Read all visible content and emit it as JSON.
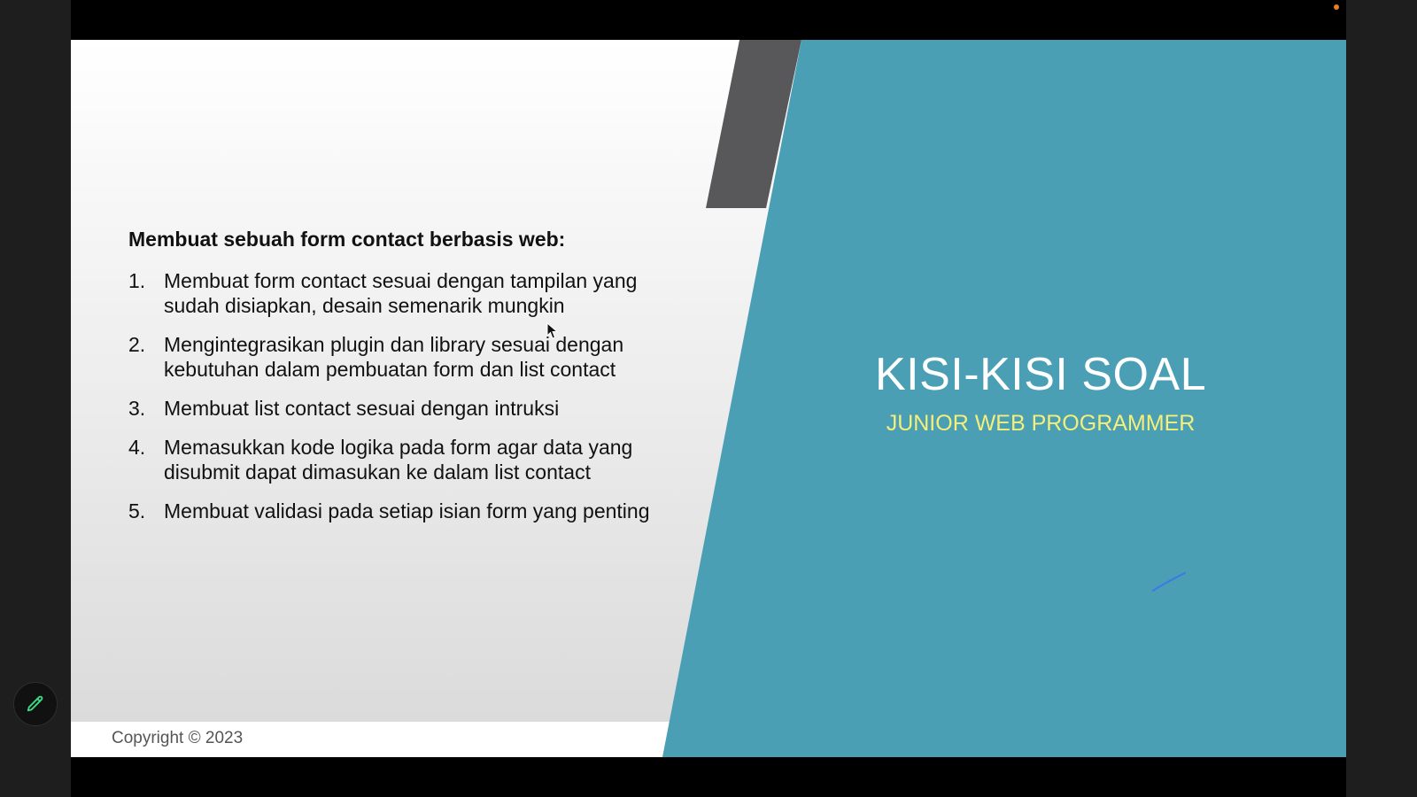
{
  "slide": {
    "heading": "Membuat sebuah form contact berbasis web:",
    "tasks": [
      {
        "num": "1.",
        "text": "Membuat form contact sesuai dengan tampilan yang sudah disiapkan, desain semenarik mungkin"
      },
      {
        "num": "2.",
        "text": "Mengintegrasikan plugin dan library sesuai dengan kebutuhan dalam pembuatan form dan list contact"
      },
      {
        "num": "3.",
        "text": "Membuat list contact sesuai dengan intruksi"
      },
      {
        "num": "4.",
        "text": "Memasukkan kode logika pada form agar data yang disubmit dapat dimasukan ke dalam list contact"
      },
      {
        "num": "5.",
        "text": "Membuat validasi pada setiap isian form yang penting"
      }
    ],
    "title": "KISI-KISI SOAL",
    "subtitle": "JUNIOR WEB PROGRAMMER",
    "copyright": "Copyright © 2023"
  },
  "toolbar": {
    "pen_icon": "pencil-icon"
  },
  "colors": {
    "teal": "#4a9fb5",
    "dark_band": "#58585a",
    "subtitle": "#f4ee7a",
    "pen_icon": "#3ddc84",
    "recording_dot": "#e67e22"
  }
}
